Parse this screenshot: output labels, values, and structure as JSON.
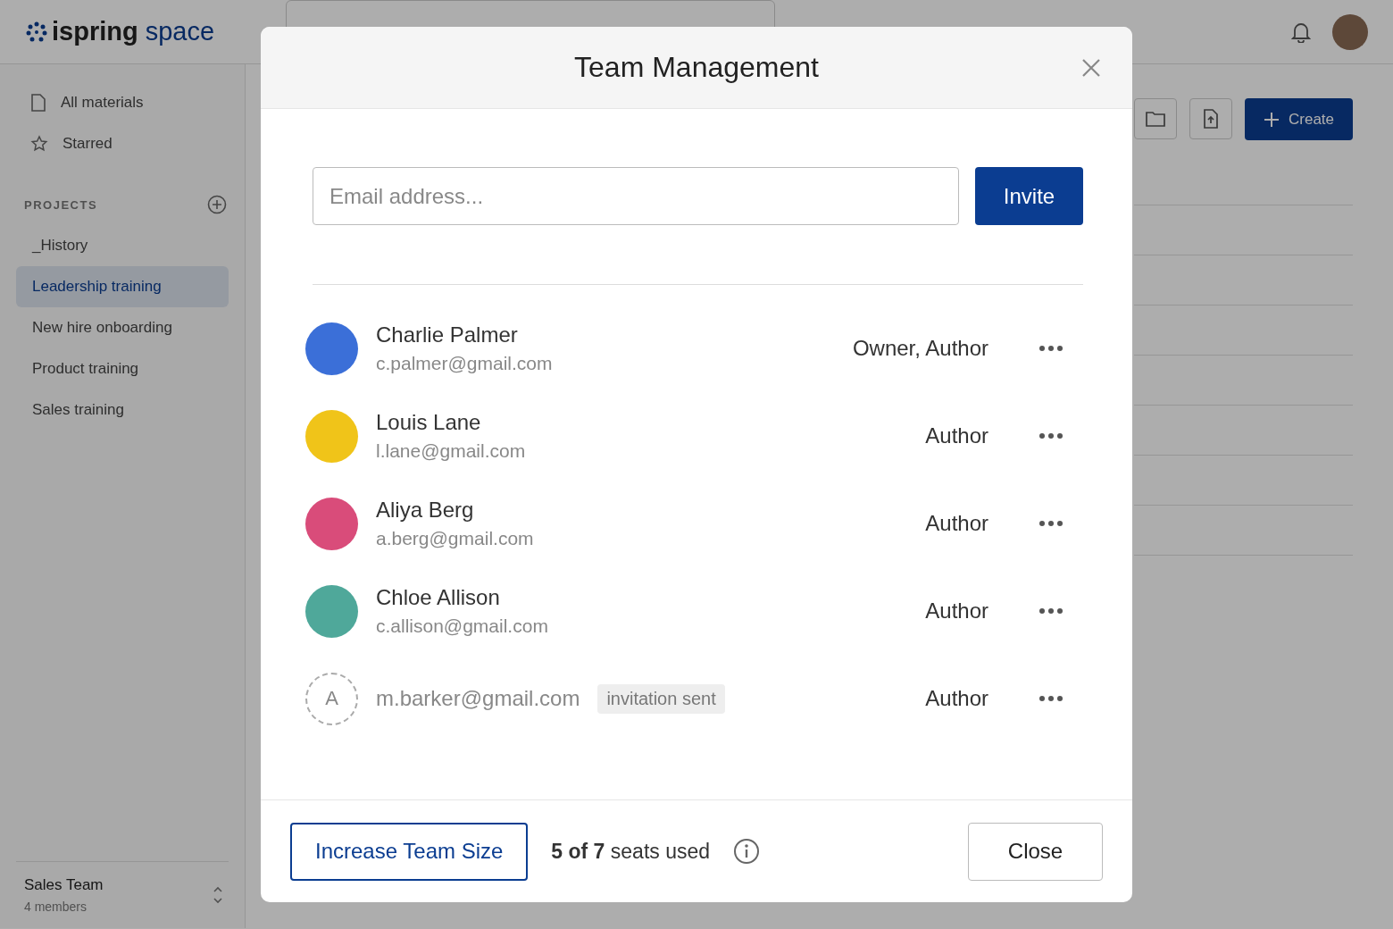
{
  "header": {
    "logo": {
      "name": "ispring",
      "suffix": "space"
    }
  },
  "sidebar": {
    "nav": [
      {
        "label": "All materials",
        "kind": "file"
      },
      {
        "label": "Starred",
        "kind": "star"
      }
    ],
    "projects_heading": "PROJECTS",
    "projects": [
      {
        "label": "_History",
        "selected": false
      },
      {
        "label": "Leadership training",
        "selected": true
      },
      {
        "label": "New hire onboarding",
        "selected": false
      },
      {
        "label": "Product training",
        "selected": false
      },
      {
        "label": "Sales training",
        "selected": false
      }
    ],
    "team": {
      "name": "Sales Team",
      "members": "4 members"
    }
  },
  "toolbar": {
    "create_label": "Create"
  },
  "dialog": {
    "title": "Team Management",
    "email": {
      "placeholder": "Email address..."
    },
    "invite_label": "Invite",
    "members": [
      {
        "kind": "member",
        "name": "Charlie Palmer",
        "email": "c.palmer@gmail.com",
        "role": "Owner, Author",
        "color": "#3b6fd8"
      },
      {
        "kind": "member",
        "name": "Louis Lane",
        "email": "l.lane@gmail.com",
        "role": "Author",
        "color": "#f0c419"
      },
      {
        "kind": "member",
        "name": "Aliya Berg",
        "email": "a.berg@gmail.com",
        "role": "Author",
        "color": "#d94c7a"
      },
      {
        "kind": "member",
        "name": "Chloe Allison",
        "email": "c.allison@gmail.com",
        "role": "Author",
        "color": "#4fa89a"
      },
      {
        "kind": "invited",
        "initial": "A",
        "email": "m.barker@gmail.com",
        "badge": "invitation sent",
        "role": "Author"
      }
    ],
    "increase_label": "Increase Team Size",
    "seats": "**5 of 7** seats used",
    "close_label": "Close"
  }
}
